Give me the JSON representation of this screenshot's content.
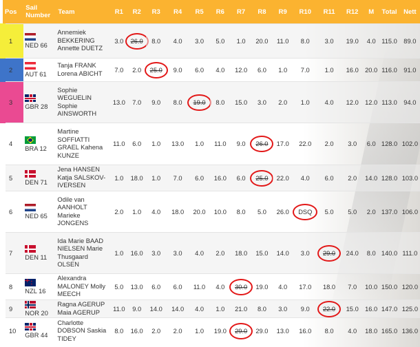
{
  "headers": {
    "pos": "Pos",
    "sail": "Sail Number",
    "team": "Team",
    "r1": "R1",
    "r2": "R2",
    "r3": "R3",
    "r4": "R4",
    "r5": "R5",
    "r6": "R6",
    "r7": "R7",
    "r8": "R8",
    "r9": "R9",
    "r10": "R10",
    "r11": "R11",
    "r12": "R12",
    "m": "M",
    "total": "Total",
    "nett": "Nett"
  },
  "colors": {
    "header_bg": "#fbb330",
    "discard_circle": "#e21717",
    "pos1": "#f5ee3a",
    "pos2": "#3e74c9",
    "pos3": "#ea4a92"
  },
  "rows": [
    {
      "pos": "1",
      "flag": "ned",
      "sail": "NED 66",
      "team": "Annemiek BEKKERING Annette DUETZ",
      "r": [
        "3.0",
        "26.0",
        "8.0",
        "4.0",
        "3.0",
        "5.0",
        "1.0",
        "20.0",
        "11.0",
        "8.0",
        "3.0",
        "19.0"
      ],
      "m": "4.0",
      "total": "115.0",
      "nett": "89.0",
      "discard": 1
    },
    {
      "pos": "2",
      "flag": "aut",
      "sail": "AUT 61",
      "team": "Tanja FRANK Lorena ABICHT",
      "r": [
        "7.0",
        "2.0",
        "25.0",
        "9.0",
        "6.0",
        "4.0",
        "12.0",
        "6.0",
        "1.0",
        "7.0",
        "1.0",
        "16.0"
      ],
      "m": "20.0",
      "total": "116.0",
      "nett": "91.0",
      "discard": 2
    },
    {
      "pos": "3",
      "flag": "gbr",
      "sail": "GBR 28",
      "team": "Sophie WEGUELIN Sophie AINSWORTH",
      "r": [
        "13.0",
        "7.0",
        "9.0",
        "8.0",
        "19.0",
        "8.0",
        "15.0",
        "3.0",
        "2.0",
        "1.0",
        "4.0",
        "12.0"
      ],
      "m": "12.0",
      "total": "113.0",
      "nett": "94.0",
      "discard": 4
    },
    {
      "pos": "4",
      "flag": "bra",
      "sail": "BRA 12",
      "team": "Martine SOFFIATTI GRAEL Kahena KUNZE",
      "r": [
        "11.0",
        "6.0",
        "1.0",
        "13.0",
        "1.0",
        "11.0",
        "9.0",
        "26.0",
        "17.0",
        "22.0",
        "2.0",
        "3.0"
      ],
      "m": "6.0",
      "total": "128.0",
      "nett": "102.0",
      "discard": 7
    },
    {
      "pos": "5",
      "flag": "den",
      "sail": "DEN 71",
      "team": "Jena HANSEN Katja SALSKOV-IVERSEN",
      "r": [
        "1.0",
        "18.0",
        "1.0",
        "7.0",
        "6.0",
        "16.0",
        "6.0",
        "25.0",
        "22.0",
        "4.0",
        "6.0",
        "2.0"
      ],
      "m": "14.0",
      "total": "128.0",
      "nett": "103.0",
      "discard": 7
    },
    {
      "pos": "6",
      "flag": "ned",
      "sail": "NED 65",
      "team": "Odile van AANHOLT Marieke JONGENS",
      "r": [
        "2.0",
        "1.0",
        "4.0",
        "18.0",
        "20.0",
        "10.0",
        "8.0",
        "5.0",
        "26.0",
        "DSQ",
        "5.0",
        "5.0"
      ],
      "m": "2.0",
      "total": "137.0",
      "nett": "106.0",
      "discard": 9
    },
    {
      "pos": "7",
      "flag": "den",
      "sail": "DEN 11",
      "team": "Ida Marie BAAD NIELSEN Marie Thusgaard OLSEN",
      "r": [
        "1.0",
        "16.0",
        "3.0",
        "3.0",
        "4.0",
        "2.0",
        "18.0",
        "15.0",
        "14.0",
        "3.0",
        "29.0",
        "24.0"
      ],
      "m": "8.0",
      "total": "140.0",
      "nett": "111.0",
      "discard": 10
    },
    {
      "pos": "8",
      "flag": "nzl",
      "sail": "NZL 16",
      "team": "Alexandra MALONEY Molly MEECH",
      "r": [
        "5.0",
        "13.0",
        "6.0",
        "6.0",
        "11.0",
        "4.0",
        "30.0",
        "19.0",
        "4.0",
        "17.0",
        "18.0",
        "7.0"
      ],
      "m": "10.0",
      "total": "150.0",
      "nett": "120.0",
      "discard": 6
    },
    {
      "pos": "9",
      "flag": "nor",
      "sail": "NOR 20",
      "team": "Ragna AGERUP Maia AGERUP",
      "r": [
        "11.0",
        "9.0",
        "14.0",
        "14.0",
        "4.0",
        "1.0",
        "21.0",
        "8.0",
        "3.0",
        "9.0",
        "22.0",
        "15.0"
      ],
      "m": "16.0",
      "total": "147.0",
      "nett": "125.0",
      "discard": 10
    },
    {
      "pos": "10",
      "flag": "gbr",
      "sail": "GBR 44",
      "team": "Charlotte DOBSON Saskia TIDEY",
      "r": [
        "8.0",
        "16.0",
        "2.0",
        "2.0",
        "1.0",
        "19.0",
        "29.0",
        "29.0",
        "13.0",
        "16.0",
        "8.0",
        "4.0"
      ],
      "m": "18.0",
      "total": "165.0",
      "nett": "136.0",
      "discard": 6
    }
  ]
}
